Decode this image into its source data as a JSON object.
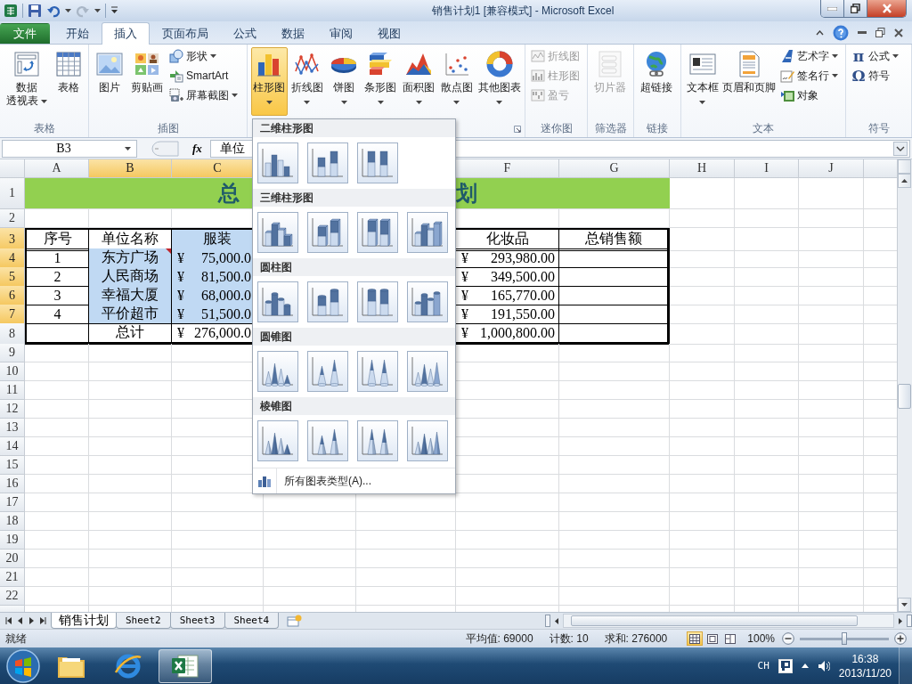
{
  "window": {
    "title": "销售计划1 [兼容模式] - Microsoft Excel"
  },
  "ribbon_tabs": [
    {
      "label": "文件",
      "kind": "file",
      "selected": false
    },
    {
      "label": "开始",
      "kind": "tab",
      "selected": false
    },
    {
      "label": "插入",
      "kind": "tab",
      "selected": true
    },
    {
      "label": "页面布局",
      "kind": "tab",
      "selected": false
    },
    {
      "label": "公式",
      "kind": "tab",
      "selected": false
    },
    {
      "label": "数据",
      "kind": "tab",
      "selected": false
    },
    {
      "label": "审阅",
      "kind": "tab",
      "selected": false
    },
    {
      "label": "视图",
      "kind": "tab",
      "selected": false
    }
  ],
  "ribbon_groups": [
    {
      "label": "表格",
      "launcher": false,
      "items": [
        {
          "lines": [
            "数据",
            "透视表"
          ],
          "kind": "large",
          "dropdown": true,
          "disabled": false,
          "pressed": false
        },
        {
          "label": "表格",
          "kind": "large",
          "dropdown": false,
          "disabled": false,
          "pressed": false
        }
      ]
    },
    {
      "label": "插图",
      "launcher": false,
      "items": [
        {
          "label": "图片",
          "kind": "large",
          "dropdown": false,
          "disabled": false,
          "pressed": false
        },
        {
          "label": "剪贴画",
          "kind": "large",
          "dropdown": false,
          "disabled": false,
          "pressed": false
        },
        {
          "label": "形状",
          "kind": "small",
          "dropdown": true,
          "disabled": false,
          "pressed": false
        },
        {
          "label": "SmartArt",
          "kind": "small",
          "dropdown": false,
          "disabled": false,
          "pressed": false
        },
        {
          "label": "屏幕截图",
          "kind": "small",
          "dropdown": true,
          "disabled": false,
          "pressed": false
        }
      ]
    },
    {
      "launcher": true,
      "items": [
        {
          "label": "柱形图",
          "kind": "large",
          "dropdown": true,
          "disabled": false,
          "pressed": true
        },
        {
          "label": "折线图",
          "kind": "large",
          "dropdown": true,
          "disabled": false,
          "pressed": false
        },
        {
          "label": "饼图",
          "kind": "large",
          "dropdown": true,
          "disabled": false,
          "pressed": false
        },
        {
          "label": "条形图",
          "kind": "large",
          "dropdown": true,
          "disabled": false,
          "pressed": false
        },
        {
          "label": "面积图",
          "kind": "large",
          "dropdown": true,
          "disabled": false,
          "pressed": false
        },
        {
          "label": "散点图",
          "kind": "large",
          "dropdown": true,
          "disabled": false,
          "pressed": false
        },
        {
          "label": "其他图表",
          "kind": "large",
          "dropdown": true,
          "disabled": false,
          "pressed": false
        }
      ]
    },
    {
      "label": "迷你图",
      "launcher": false,
      "items": [
        {
          "label": "折线图",
          "kind": "small",
          "dropdown": false,
          "disabled": true,
          "pressed": false
        },
        {
          "label": "柱形图",
          "kind": "small",
          "dropdown": false,
          "disabled": true,
          "pressed": false
        },
        {
          "label": "盈亏",
          "kind": "small",
          "dropdown": false,
          "disabled": true,
          "pressed": false
        }
      ]
    },
    {
      "label": "筛选器",
      "launcher": false,
      "items": [
        {
          "label": "切片器",
          "kind": "large",
          "dropdown": false,
          "disabled": true,
          "pressed": false
        }
      ]
    },
    {
      "label": "链接",
      "launcher": false,
      "items": [
        {
          "label": "超链接",
          "kind": "large",
          "dropdown": false,
          "disabled": false,
          "pressed": false
        }
      ]
    },
    {
      "label": "文本",
      "launcher": false,
      "items": [
        {
          "label": "文本框",
          "kind": "large",
          "dropdown": true,
          "disabled": false,
          "pressed": false
        },
        {
          "label": "页眉和页脚",
          "kind": "large",
          "dropdown": false,
          "disabled": false,
          "pressed": false
        },
        {
          "label": "艺术字",
          "kind": "small",
          "dropdown": true,
          "disabled": false,
          "pressed": false
        },
        {
          "label": "签名行",
          "kind": "small",
          "dropdown": true,
          "disabled": false,
          "pressed": false
        },
        {
          "label": "对象",
          "kind": "small",
          "dropdown": false,
          "disabled": false,
          "pressed": false
        }
      ]
    },
    {
      "label": "符号",
      "launcher": false,
      "items": [
        {
          "label": "公式",
          "symbol": "π",
          "kind": "small",
          "dropdown": true,
          "disabled": false,
          "pressed": false
        },
        {
          "label": "符号",
          "symbol": "Ω",
          "kind": "small",
          "dropdown": false,
          "disabled": false,
          "pressed": false
        }
      ]
    }
  ],
  "formula_bar": {
    "name_box": "B3",
    "fx_label": "fx",
    "content": "单位"
  },
  "sheet": {
    "columns": [
      {
        "label": "A",
        "selected": false
      },
      {
        "label": "B",
        "selected": true
      },
      {
        "label": "C",
        "selected": true
      },
      {
        "label": "F",
        "selected": false
      },
      {
        "label": "G",
        "selected": false
      },
      {
        "label": "H",
        "selected": false
      },
      {
        "label": "I",
        "selected": false
      },
      {
        "label": "J",
        "selected": false
      },
      {
        "selected": false
      }
    ],
    "rows": [
      {
        "number": "1",
        "selected": false,
        "kind": "title",
        "texts": [
          "总",
          "划"
        ]
      },
      {
        "number": "2",
        "selected": false,
        "kind": "blank"
      },
      {
        "number": "3",
        "selected": true,
        "kind": "table",
        "cells": [
          {
            "kind": "text",
            "text": "序号",
            "selected": false,
            "comment": false
          },
          {
            "kind": "text",
            "text": "单位名称",
            "selected": false,
            "comment": false
          },
          {
            "kind": "text",
            "text": "服装",
            "selected": true,
            "comment": false
          },
          {
            "kind": "text",
            "text": "化妆品",
            "selected": false,
            "comment": false
          },
          {
            "kind": "text",
            "text": "总销售额",
            "selected": false,
            "comment": false
          }
        ]
      },
      {
        "number": "4",
        "selected": true,
        "kind": "table",
        "cells": [
          {
            "kind": "text",
            "text": "1",
            "selected": false,
            "comment": false
          },
          {
            "kind": "text",
            "text": "东方广场",
            "selected": true,
            "comment": true
          },
          {
            "kind": "money",
            "currency": "¥",
            "amount": "75,000.0",
            "selected": true,
            "comment": false
          },
          {
            "kind": "money",
            "currency": "¥",
            "amount": "293,980.00",
            "selected": false,
            "comment": false
          },
          {
            "kind": "empty",
            "selected": false,
            "comment": false
          }
        ]
      },
      {
        "number": "5",
        "selected": true,
        "kind": "table",
        "cells": [
          {
            "kind": "text",
            "text": "2",
            "selected": false,
            "comment": false
          },
          {
            "kind": "text",
            "text": "人民商场",
            "selected": true,
            "comment": false
          },
          {
            "kind": "money",
            "currency": "¥",
            "amount": "81,500.0",
            "selected": true,
            "comment": false
          },
          {
            "kind": "money",
            "currency": "¥",
            "amount": "349,500.00",
            "selected": false,
            "comment": false
          },
          {
            "kind": "empty",
            "selected": false,
            "comment": false
          }
        ]
      },
      {
        "number": "6",
        "selected": true,
        "kind": "table",
        "cells": [
          {
            "kind": "text",
            "text": "3",
            "selected": false,
            "comment": false
          },
          {
            "kind": "text",
            "text": "幸福大厦",
            "selected": true,
            "comment": false
          },
          {
            "kind": "money",
            "currency": "¥",
            "amount": "68,000.0",
            "selected": true,
            "comment": false
          },
          {
            "kind": "money",
            "currency": "¥",
            "amount": "165,770.00",
            "selected": false,
            "comment": false
          },
          {
            "kind": "empty",
            "selected": false,
            "comment": false
          }
        ]
      },
      {
        "number": "7",
        "selected": true,
        "kind": "table",
        "cells": [
          {
            "kind": "text",
            "text": "4",
            "selected": false,
            "comment": false
          },
          {
            "kind": "text",
            "text": "平价超市",
            "selected": true,
            "comment": false
          },
          {
            "kind": "money",
            "currency": "¥",
            "amount": "51,500.0",
            "selected": true,
            "comment": false
          },
          {
            "kind": "money",
            "currency": "¥",
            "amount": "191,550.00",
            "selected": false,
            "comment": false
          },
          {
            "kind": "empty",
            "selected": false,
            "comment": false
          }
        ]
      },
      {
        "number": "8",
        "selected": false,
        "kind": "table",
        "cells": [
          {
            "kind": "empty",
            "selected": false,
            "comment": false
          },
          {
            "kind": "text",
            "text": "总计",
            "selected": false,
            "comment": false
          },
          {
            "kind": "money",
            "currency": "¥",
            "amount": "276,000.0",
            "selected": false,
            "comment": false
          },
          {
            "kind": "money",
            "currency": "¥",
            "amount": "1,000,800.00",
            "selected": false,
            "comment": false
          },
          {
            "kind": "empty",
            "selected": false,
            "comment": false
          }
        ]
      },
      {
        "number": "9",
        "selected": false,
        "kind": "blank"
      },
      {
        "number": "10",
        "selected": false,
        "kind": "blank"
      },
      {
        "number": "11",
        "selected": false,
        "kind": "blank"
      },
      {
        "number": "12",
        "selected": false,
        "kind": "blank"
      },
      {
        "number": "13",
        "selected": false,
        "kind": "blank"
      },
      {
        "number": "14",
        "selected": false,
        "kind": "blank"
      },
      {
        "number": "15",
        "selected": false,
        "kind": "blank"
      },
      {
        "number": "16",
        "selected": false,
        "kind": "blank"
      },
      {
        "number": "17",
        "selected": false,
        "kind": "blank"
      },
      {
        "number": "18",
        "selected": false,
        "kind": "blank"
      },
      {
        "number": "19",
        "selected": false,
        "kind": "blank"
      },
      {
        "number": "20",
        "selected": false,
        "kind": "blank"
      },
      {
        "number": "21",
        "selected": false,
        "kind": "blank"
      },
      {
        "number": "22",
        "selected": false,
        "kind": "blank"
      }
    ]
  },
  "chart_menu": {
    "sections": [
      {
        "title": "二维柱形图",
        "options": [
          {
            "kind": "clustered"
          },
          {
            "kind": "stacked"
          },
          {
            "kind": "percent"
          }
        ]
      },
      {
        "title": "三维柱形图",
        "options": [
          {
            "kind": "clustered"
          },
          {
            "kind": "stacked"
          },
          {
            "kind": "percent"
          },
          {
            "kind": "depth"
          }
        ]
      },
      {
        "title": "圆柱图",
        "options": [
          {
            "kind": "clustered"
          },
          {
            "kind": "stacked"
          },
          {
            "kind": "percent"
          },
          {
            "kind": "depth"
          }
        ]
      },
      {
        "title": "圆锥图",
        "options": [
          {
            "kind": "clustered"
          },
          {
            "kind": "stacked"
          },
          {
            "kind": "percent"
          },
          {
            "kind": "depth"
          }
        ]
      },
      {
        "title": "棱锥图",
        "options": [
          {
            "kind": "clustered"
          },
          {
            "kind": "stacked"
          },
          {
            "kind": "percent"
          },
          {
            "kind": "depth"
          }
        ]
      }
    ],
    "footer": "所有图表类型(A)..."
  },
  "sheet_tabs": [
    {
      "label": "销售计划",
      "selected": true
    },
    {
      "label": "Sheet2",
      "selected": false
    },
    {
      "label": "Sheet3",
      "selected": false
    },
    {
      "label": "Sheet4",
      "selected": false
    }
  ],
  "status_bar": {
    "ready": "就绪",
    "stats": [
      "平均值: 69000",
      "计数: 10",
      "求和: 276000"
    ],
    "views": [
      {
        "selected": true
      },
      {
        "selected": false
      },
      {
        "selected": false
      }
    ],
    "zoom": "100%",
    "zoom_slider": {
      "level": 0.5
    }
  },
  "taskbar": {
    "apps": [
      {
        "kind": "folder",
        "active": false
      },
      {
        "kind": "browser",
        "active": false
      },
      {
        "kind": "spreadsheet",
        "active": true
      }
    ],
    "language": "CH",
    "time": "16:38",
    "date": "2013/11/20"
  }
}
